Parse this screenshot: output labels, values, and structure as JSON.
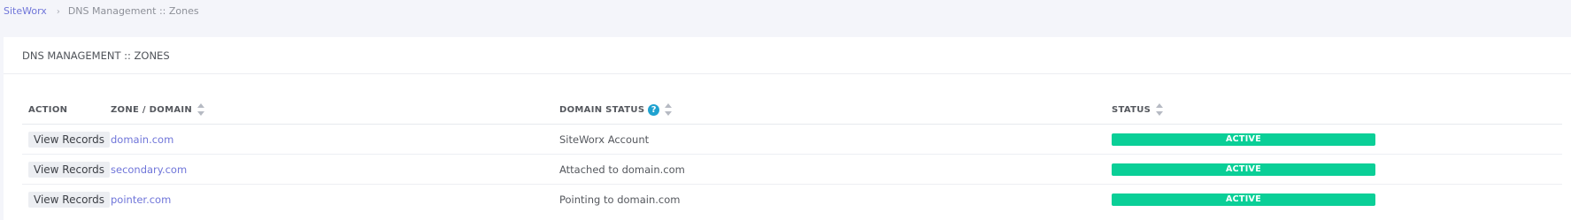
{
  "breadcrumb": {
    "root": "SiteWorx",
    "separator": "›",
    "current": "DNS Management :: Zones"
  },
  "card": {
    "title": "DNS MANAGEMENT :: ZONES"
  },
  "table": {
    "headers": {
      "action": "ACTION",
      "zone": "ZONE / DOMAIN",
      "domain_status": "DOMAIN STATUS",
      "status": "STATUS"
    },
    "help_glyph": "?",
    "rows": [
      {
        "action": "View Records",
        "domain": "domain.com",
        "domain_status": "SiteWorx Account",
        "status": "ACTIVE"
      },
      {
        "action": "View Records",
        "domain": "secondary.com",
        "domain_status": "Attached to domain.com",
        "status": "ACTIVE"
      },
      {
        "action": "View Records",
        "domain": "pointer.com",
        "domain_status": "Pointing to domain.com",
        "status": "ACTIVE"
      }
    ]
  },
  "colors": {
    "link": "#6f75d9",
    "status_active": "#0acf97",
    "help_icon": "#1fa2d0"
  },
  "icons": {
    "sort": "sort-icon",
    "help": "help-icon"
  }
}
